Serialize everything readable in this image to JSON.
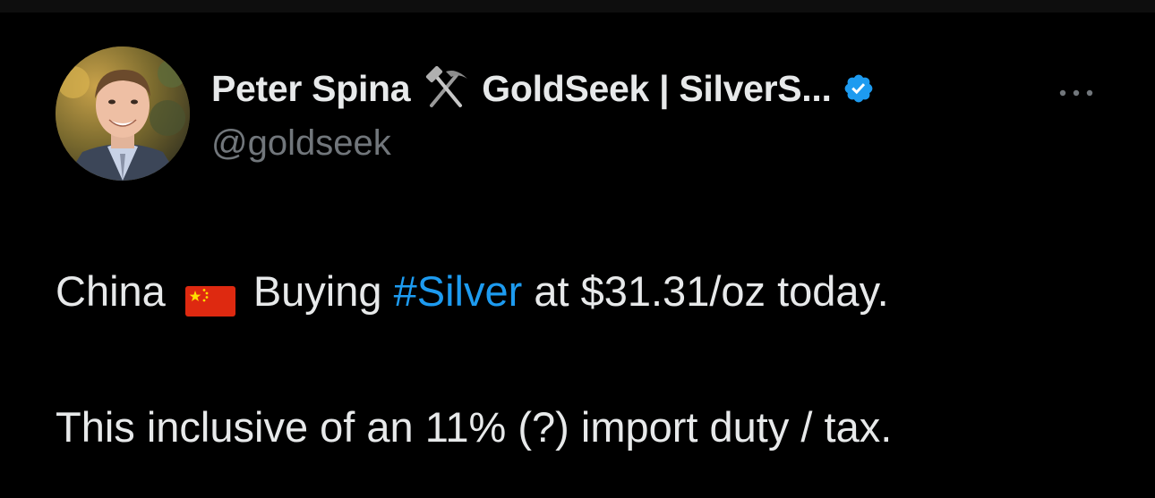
{
  "tweet": {
    "author": {
      "name_part1": "Peter Spina",
      "name_part2": "GoldSeek | SilverS...",
      "handle": "@goldseek",
      "name_icon": "hammer-and-pick-icon",
      "verified_icon": "verified-badge-icon"
    },
    "more_icon": "more-options-icon",
    "text": {
      "line1_before_flag": "China",
      "flag_icon": "china-flag-icon",
      "line1_before_hashtag": "Buying",
      "hashtag": "#Silver",
      "line1_after_hashtag": "at $31.31/oz today.",
      "line2": "This inclusive of an 11% (?) import duty / tax."
    }
  },
  "colors": {
    "background": "#000000",
    "primary_text": "#e7e9ea",
    "secondary_text": "#71767b",
    "link": "#1d9bf0",
    "verified": "#1d9bf0"
  }
}
